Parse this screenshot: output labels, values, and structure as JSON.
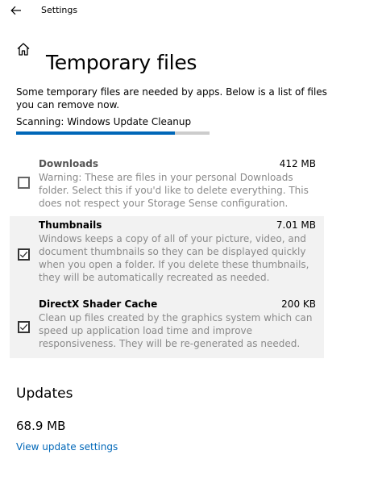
{
  "window": {
    "title": "Settings",
    "back_icon": "back-arrow-icon"
  },
  "header": {
    "title": "Temporary files",
    "icon": "home-icon"
  },
  "description": "Some temporary files are needed by apps. Below is a list of files you can remove now.",
  "scan": {
    "status": "Scanning: Windows Update Cleanup",
    "progress": 0.82,
    "accent_color": "#0067b8"
  },
  "items": [
    {
      "name": "Downloads",
      "size": "412 MB",
      "description": "Warning: These are files in your personal Downloads folder. Select this if you'd like to delete everything. This does not respect your Storage Sense configuration.",
      "checked": false
    },
    {
      "name": "Thumbnails",
      "size": "7.01 MB",
      "description": "Windows keeps a copy of all of your picture, video, and document thumbnails so they can be displayed quickly when you open a folder. If you delete these thumbnails, they will be automatically recreated as needed.",
      "checked": true
    },
    {
      "name": "DirectX Shader Cache",
      "size": "200 KB",
      "description": "Clean up files created by the graphics system which can speed up application load time and improve responsiveness. They will be re-generated as needed.",
      "checked": true
    }
  ],
  "updates": {
    "section_title": "Updates",
    "size": "68.9 MB",
    "link_label": "View update settings"
  }
}
